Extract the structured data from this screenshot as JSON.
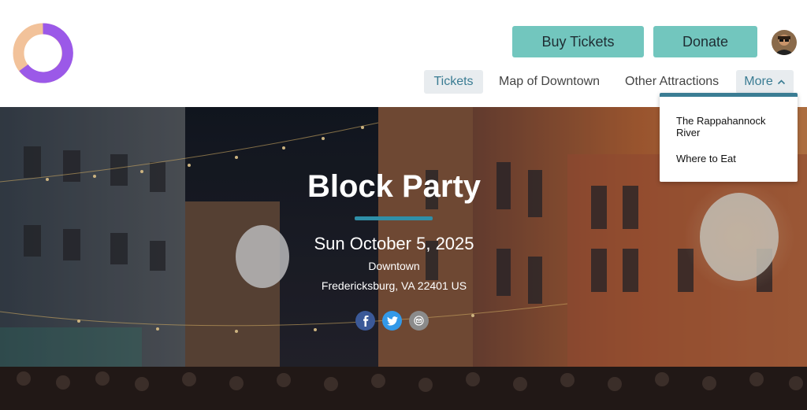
{
  "header": {
    "buy_tickets_label": "Buy Tickets",
    "donate_label": "Donate"
  },
  "nav": {
    "items": [
      {
        "label": "Tickets"
      },
      {
        "label": "Map of Downtown"
      },
      {
        "label": "Other Attractions"
      },
      {
        "label": "More"
      }
    ]
  },
  "dropdown": {
    "items": [
      {
        "label": "The Rappahannock River"
      },
      {
        "label": "Where to Eat"
      }
    ]
  },
  "event": {
    "title": "Block Party",
    "date": "Sun October 5, 2025",
    "venue": "Downtown",
    "address": "Fredericksburg, VA 22401 US"
  },
  "share": {
    "icons": [
      "facebook-icon",
      "twitter-icon",
      "email-icon"
    ]
  },
  "colors": {
    "button_bg": "#72c6be",
    "accent_blue": "#3a7c93",
    "logo_orange": "#f2c29a",
    "logo_purple": "#9b59e8",
    "facebook": "#3b5998",
    "twitter": "#3399e8",
    "email": "#8b8b8b",
    "title_underline": "#2f8fa8"
  }
}
